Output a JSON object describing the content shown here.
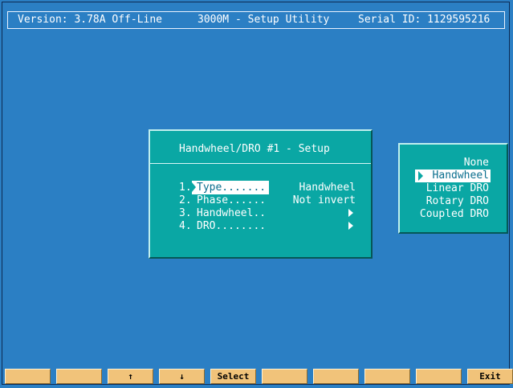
{
  "titlebar": {
    "version": "Version: 3.78A Off-Line",
    "app": "3000M - Setup Utility",
    "serial": "Serial ID: 1129595216"
  },
  "setup_panel": {
    "title": "Handwheel/DRO #1 - Setup",
    "items": [
      {
        "num": "1.",
        "label": "Type.......",
        "value": "Handwheel",
        "selected": true
      },
      {
        "num": "2.",
        "label": "Phase......",
        "value": "Not invert"
      },
      {
        "num": "3.",
        "label": "Handwheel..",
        "value": "",
        "submenu": true
      },
      {
        "num": "4.",
        "label": "DRO........",
        "value": "",
        "submenu": true
      }
    ]
  },
  "type_options": {
    "options": [
      "None",
      "Handwheel",
      "Linear DRO",
      "Rotary DRO",
      "Coupled DRO"
    ],
    "selected": "Handwheel"
  },
  "function_keys": [
    "",
    "",
    "↑",
    "↓",
    "Select",
    "",
    "",
    "",
    "",
    "Exit"
  ],
  "colors": {
    "background": "#2b7fc4",
    "panel": "#0aa7a4",
    "fkey": "#f1c37a",
    "highlight_text": "#0a6e8e"
  }
}
